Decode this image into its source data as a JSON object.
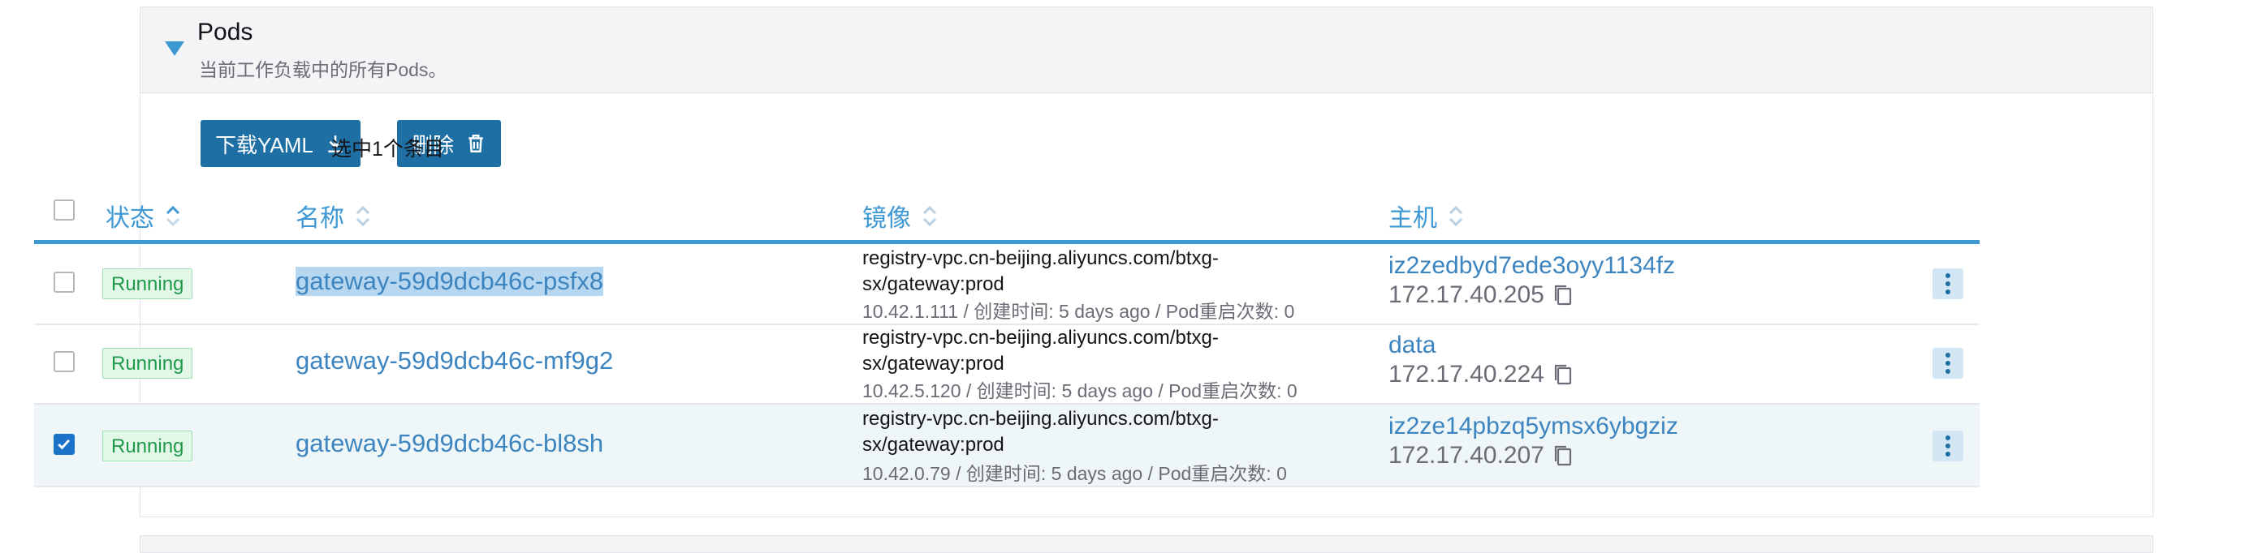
{
  "section": {
    "title": "Pods",
    "subtitle": "当前工作负载中的所有Pods。"
  },
  "toolbar": {
    "download_label": "下载YAML",
    "delete_label": "删除",
    "selected_text": "选中1个条目"
  },
  "table": {
    "columns": {
      "state": "状态",
      "name": "名称",
      "image": "镜像",
      "node": "主机"
    },
    "rows": [
      {
        "checked": false,
        "state": "Running",
        "name": "gateway-59d9dcb46c-psfx8",
        "image_line1": "registry-vpc.cn-beijing.aliyuncs.com/btxg-",
        "image_line2": "sx/gateway:prod",
        "meta": "10.42.1.111 / 创建时间: 5 days ago / Pod重启次数: 0",
        "host": "iz2zedbyd7ede3oyy1134fz",
        "ip": "172.17.40.205"
      },
      {
        "checked": false,
        "state": "Running",
        "name": "gateway-59d9dcb46c-mf9g2",
        "image_line1": "registry-vpc.cn-beijing.aliyuncs.com/btxg-",
        "image_line2": "sx/gateway:prod",
        "meta": "10.42.5.120 / 创建时间: 5 days ago / Pod重启次数: 0",
        "host": "data",
        "ip": "172.17.40.224"
      },
      {
        "checked": true,
        "state": "Running",
        "name": "gateway-59d9dcb46c-bl8sh",
        "image_line1": "registry-vpc.cn-beijing.aliyuncs.com/btxg-",
        "image_line2": "sx/gateway:prod",
        "meta": "10.42.0.79 / 创建时间: 5 days ago / Pod重启次数: 0",
        "host": "iz2ze14pbzq5ymsx6ybgziz",
        "ip": "172.17.40.207"
      }
    ]
  },
  "icons": {
    "caret": "caret-down-icon",
    "download": "download-icon",
    "delete": "trash-icon",
    "sort": "sort-icon",
    "copy": "copy-icon",
    "actions": "kebab-menu-icon"
  },
  "colors": {
    "accent": "#3d98d3",
    "button": "#1d6fa4",
    "running_text": "#1e9a4a",
    "running_bg": "#e3f7e9",
    "selected_row": "#eef6f8"
  }
}
